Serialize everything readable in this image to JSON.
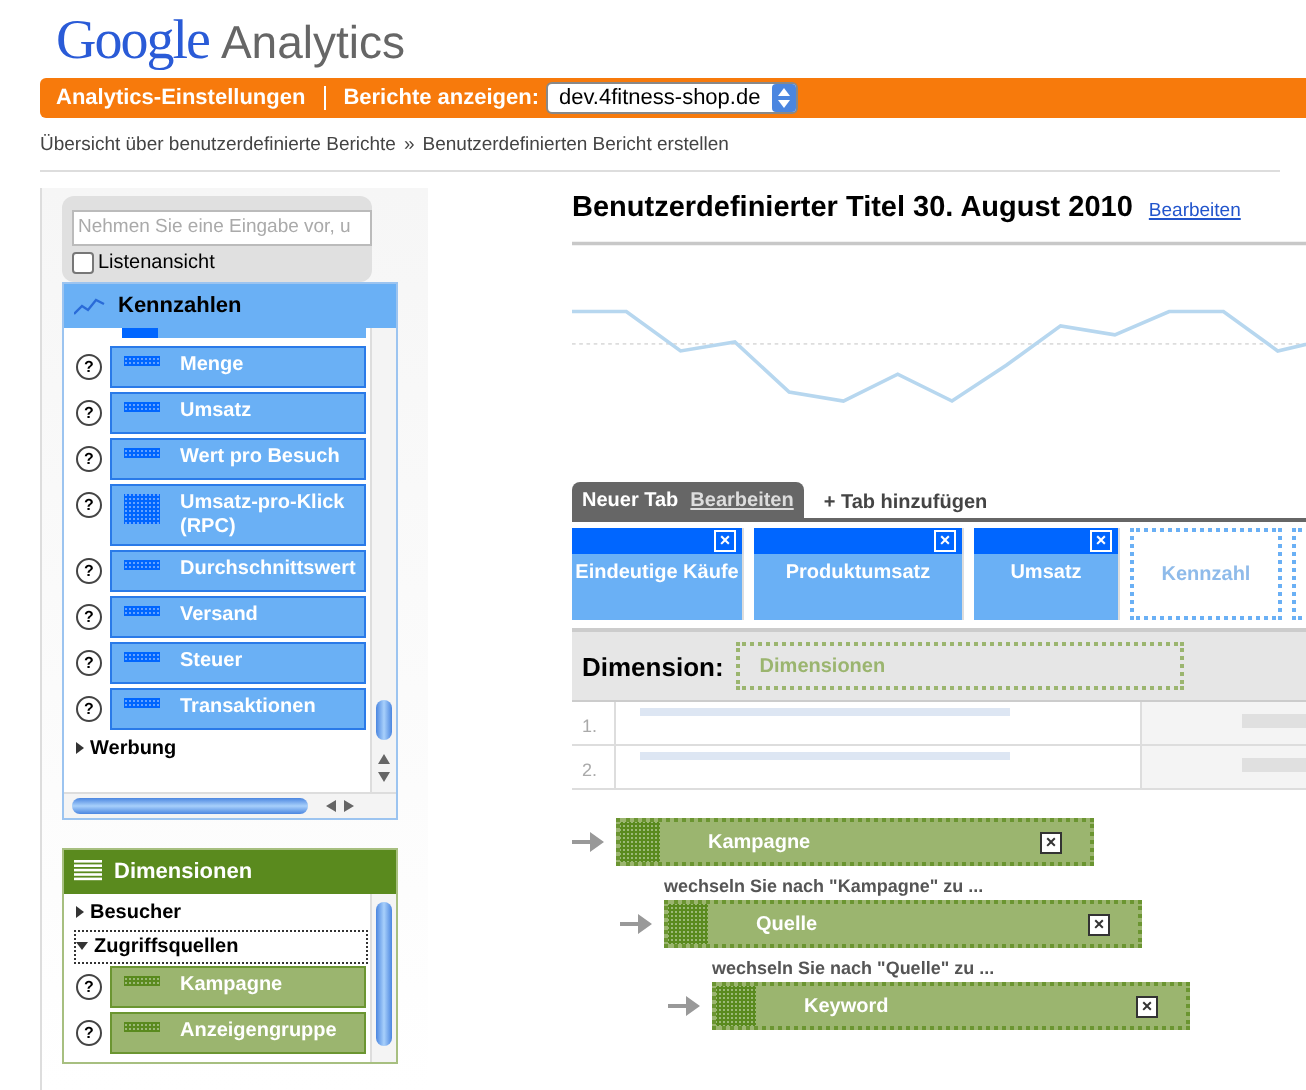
{
  "header": {
    "logo_brand": "Google",
    "logo_product": "Analytics"
  },
  "nav": {
    "settings_link": "Analytics-Einstellungen",
    "reports_label": "Berichte anzeigen:",
    "profile": "dev.4fitness-shop.de"
  },
  "breadcrumb": {
    "parent": "Übersicht über benutzerdefinierte Berichte",
    "separator": "»",
    "current": "Benutzerdefinierten Bericht erstellen"
  },
  "sidebar": {
    "search": {
      "placeholder": "Nehmen Sie eine Eingabe vor, u"
    },
    "list_view": {
      "label": "Listenansicht",
      "checked": false
    },
    "metrics": {
      "title": "Kennzahlen",
      "items": [
        {
          "kind": "item",
          "label": "Menge",
          "help": "?"
        },
        {
          "kind": "item",
          "label": "Umsatz",
          "help": "?"
        },
        {
          "kind": "item",
          "label": "Wert pro Besuch",
          "help": "?"
        },
        {
          "kind": "item",
          "label": "Umsatz-pro-Klick (RPC)",
          "help": "?"
        },
        {
          "kind": "item",
          "label": "Durchschnittswert",
          "help": "?"
        },
        {
          "kind": "item",
          "label": "Versand",
          "help": "?"
        },
        {
          "kind": "item",
          "label": "Steuer",
          "help": "?"
        },
        {
          "kind": "item",
          "label": "Transaktionen",
          "help": "?"
        },
        {
          "kind": "group",
          "label": "Werbung",
          "expanded": false
        }
      ]
    },
    "dimensions": {
      "title": "Dimensionen",
      "groups": [
        {
          "label": "Besucher",
          "expanded": false,
          "selected": false
        },
        {
          "label": "Zugriffsquellen",
          "expanded": true,
          "selected": true,
          "children": [
            {
              "label": "Kampagne",
              "help": "?"
            },
            {
              "label": "Anzeigengruppe",
              "help": "?"
            }
          ]
        }
      ]
    }
  },
  "report": {
    "title": "Benutzerdefinierter Titel 30. August 2010",
    "edit_link": "Bearbeiten",
    "tabs": [
      {
        "label": "Neuer Tab",
        "edit": "Bearbeiten",
        "selected": true
      }
    ],
    "add_tab": "+ Tab hinzufügen",
    "metric_tiles": [
      {
        "kind": "metric",
        "label": "Eindeutige Käufe",
        "remove": "×"
      },
      {
        "kind": "metric",
        "label": "Produktumsatz",
        "remove": "×"
      },
      {
        "kind": "metric",
        "label": "Umsatz",
        "remove": "×"
      },
      {
        "kind": "empty",
        "label": "Kennzahl"
      },
      {
        "kind": "empty"
      }
    ],
    "dimension_label": "Dimension:",
    "dimension_drop": "Dimensionen",
    "rows": [
      {
        "number": "1."
      },
      {
        "number": "2."
      }
    ],
    "drilldown": [
      {
        "label": "Kampagne",
        "remove": "×"
      },
      {
        "hint": "wechseln Sie nach **\"Kampagne\"** zu ...",
        "label": "Quelle",
        "remove": "×"
      },
      {
        "hint": "wechseln Sie nach **\"Quelle\"** zu ...",
        "label": "Keyword",
        "remove": "×"
      }
    ]
  }
}
